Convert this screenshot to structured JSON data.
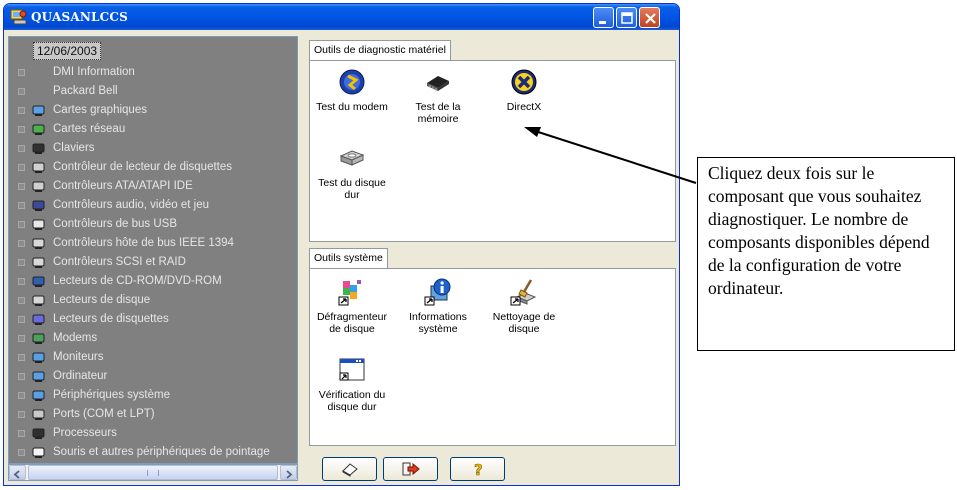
{
  "window": {
    "title": "QUASANLCCS",
    "icon": "computer-tools-icon"
  },
  "tree": {
    "root_label": "12/06/2003",
    "items": [
      {
        "label": "DMI Information",
        "icon": "none"
      },
      {
        "label": "Packard Bell",
        "icon": "none"
      },
      {
        "label": "Cartes graphiques",
        "icon": "monitor-icon"
      },
      {
        "label": "Cartes réseau",
        "icon": "network-card-icon"
      },
      {
        "label": "Claviers",
        "icon": "keyboard-icon"
      },
      {
        "label": "Contrôleur de lecteur de disquettes",
        "icon": "floppy-controller-icon"
      },
      {
        "label": "Contrôleurs ATA/ATAPI IDE",
        "icon": "ide-controller-icon"
      },
      {
        "label": "Contrôleurs audio, vidéo et jeu",
        "icon": "audio-icon"
      },
      {
        "label": "Contrôleurs de bus USB",
        "icon": "usb-icon"
      },
      {
        "label": "Contrôleurs hôte de bus IEEE 1394",
        "icon": "firewire-icon"
      },
      {
        "label": "Contrôleurs SCSI et RAID",
        "icon": "scsi-icon"
      },
      {
        "label": "Lecteurs de CD-ROM/DVD-ROM",
        "icon": "cdrom-icon"
      },
      {
        "label": "Lecteurs de disque",
        "icon": "disk-drive-icon"
      },
      {
        "label": "Lecteurs de disquettes",
        "icon": "floppy-drive-icon"
      },
      {
        "label": "Modems",
        "icon": "modem-icon"
      },
      {
        "label": "Moniteurs",
        "icon": "monitor-icon"
      },
      {
        "label": "Ordinateur",
        "icon": "computer-icon"
      },
      {
        "label": "Périphériques système",
        "icon": "system-device-icon"
      },
      {
        "label": "Ports (COM et LPT)",
        "icon": "port-icon"
      },
      {
        "label": "Processeurs",
        "icon": "processor-icon"
      },
      {
        "label": "Souris et autres périphériques de pointage",
        "icon": "mouse-icon"
      }
    ]
  },
  "hardware_tools": {
    "tab_label": "Outils de diagnostic matériel",
    "tools": [
      {
        "label": "Test du modem",
        "icon": "modem-test-icon"
      },
      {
        "label": "Test de la mémoire",
        "icon": "memory-chip-icon"
      },
      {
        "label": "DirectX",
        "icon": "directx-icon"
      },
      {
        "label": "Test du disque dur",
        "icon": "hard-disk-icon"
      }
    ]
  },
  "system_tools": {
    "tab_label": "Outils système",
    "tools": [
      {
        "label": "Défragmenteur de disque",
        "icon": "defragmenter-icon"
      },
      {
        "label": "Informations système",
        "icon": "system-info-icon"
      },
      {
        "label": "Nettoyage de disque",
        "icon": "disk-cleanup-icon"
      },
      {
        "label": "Vérification du disque dur",
        "icon": "disk-check-icon"
      }
    ]
  },
  "bottom_buttons": [
    {
      "name": "eraser-button",
      "icon": "eraser-icon"
    },
    {
      "name": "exit-button",
      "icon": "exit-arrow-icon"
    },
    {
      "name": "help-button",
      "icon": "question-mark-icon",
      "label": "?"
    }
  ],
  "callout": {
    "text": "Cliquez deux fois sur le composant que vous souhaitez diagnostiquer. Le nombre de composants disponibles dépend de la configuration de votre ordinateur."
  },
  "colors": {
    "titlebar": "#0055e5",
    "window_bg": "#ece9d8",
    "tree_bg": "#808080",
    "tree_text": "#e6e6e6"
  }
}
